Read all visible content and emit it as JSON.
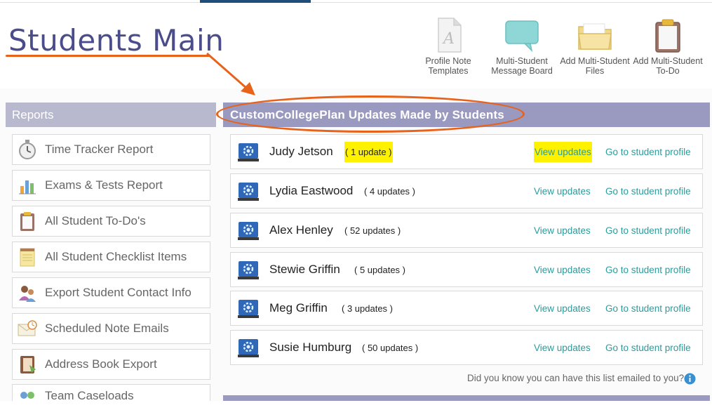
{
  "page_title": "Students Main",
  "toolbar": {
    "profile_note": "Profile Note Templates",
    "message_board": "Multi-Student Message Board",
    "add_files": "Add Multi-Student Files",
    "add_todo": "Add Multi-Student To-Do"
  },
  "reports": {
    "heading": "Reports",
    "items": [
      {
        "label": "Time Tracker Report",
        "icon": "stopwatch-icon"
      },
      {
        "label": "Exams & Tests Report",
        "icon": "bar-chart-icon"
      },
      {
        "label": "All Student To-Do's",
        "icon": "clipboard-icon"
      },
      {
        "label": "All Student Checklist Items",
        "icon": "notepad-icon"
      },
      {
        "label": "Export Student Contact Info",
        "icon": "contacts-icon"
      },
      {
        "label": "Scheduled Note Emails",
        "icon": "clock-envelope-icon"
      },
      {
        "label": "Address Book Export",
        "icon": "address-book-icon"
      },
      {
        "label": "Team Caseloads",
        "icon": "team-icon"
      }
    ]
  },
  "updates": {
    "heading": "CustomCollegePlan Updates Made by Students",
    "view_label": "View updates",
    "goto_label": "Go to student profile",
    "rows": [
      {
        "name": "Judy Jetson",
        "count": "( 1 update )"
      },
      {
        "name": "Lydia Eastwood",
        "count": "( 4 updates )"
      },
      {
        "name": "Alex Henley",
        "count": "( 52 updates )"
      },
      {
        "name": "Stewie Griffin",
        "count": "( 5 updates )"
      },
      {
        "name": "Meg Griffin",
        "count": "( 3 updates )"
      },
      {
        "name": "Susie Humburg",
        "count": "( 50 updates )"
      }
    ],
    "hint": "Did you know you can have this list emailed to you?"
  },
  "colors": {
    "accent_orange": "#e8621a",
    "title_purple": "#4b4d8b",
    "link_teal": "#2a9c9c",
    "highlight_yellow": "#fff200"
  }
}
